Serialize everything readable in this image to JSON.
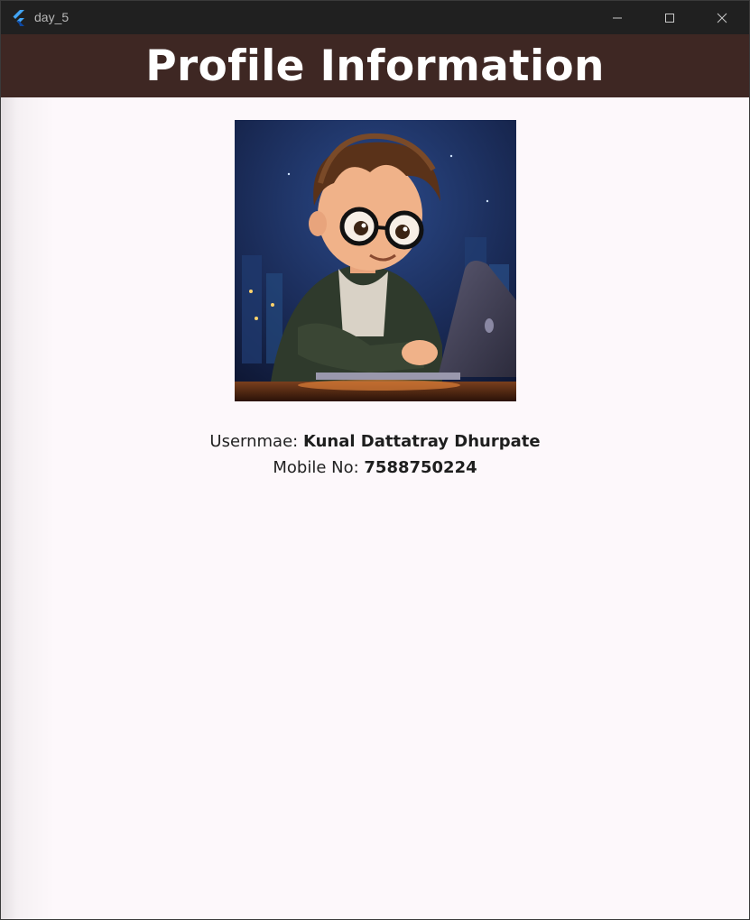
{
  "window": {
    "title": "day_5",
    "app_icon": "flutter-logo-icon",
    "controls": [
      "minimize-icon",
      "maximize-icon",
      "close-icon"
    ]
  },
  "appbar": {
    "title": "Profile Information",
    "background": "#3e2723",
    "text_color": "#ffffff"
  },
  "profile": {
    "avatar": "cartoon-boy-laptop-avatar",
    "username_label": "Usernmae: ",
    "username_value": "Kunal Dattatray Dhurpate",
    "mobile_label": "Mobile No: ",
    "mobile_value": "7588750224"
  },
  "colors": {
    "page_background": "#fdf8fb",
    "titlebar": "#202020"
  }
}
